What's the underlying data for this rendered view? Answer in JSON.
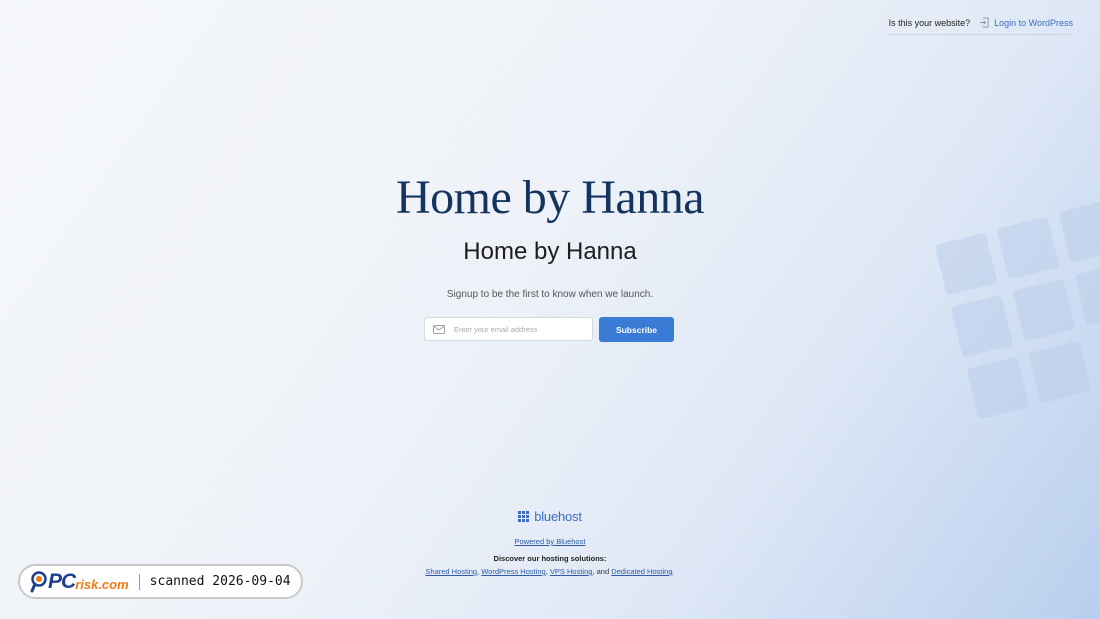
{
  "header": {
    "question": "Is this your website?",
    "login_link": "Login to WordPress"
  },
  "hero": {
    "logo_title": "Home by Hanna",
    "site_title": "Home by Hanna",
    "tagline": "Signup to be the first to know when we launch."
  },
  "signup": {
    "email_placeholder": "Enter your email address",
    "email_value": "",
    "subscribe_label": "Subscribe"
  },
  "footer": {
    "brand_name": "bluehost",
    "powered_by": "Powered by Bluehost",
    "discover_label": "Discover our hosting solutions:",
    "links": [
      "Shared Hosting",
      "WordPress Hosting",
      "VPS Hosting",
      "Dedicated Hosting"
    ],
    "sep_comma": ", ",
    "sep_and": ", and ",
    "end": "."
  },
  "watermark": {
    "brand_pc": "PC",
    "brand_risk": "risk.com",
    "scan_text": "scanned 2026-09-04"
  },
  "colors": {
    "accent": "#3a7bd5",
    "title": "#14345d",
    "link": "#3a6fbf"
  },
  "icons": {
    "login": "login-arrow-icon",
    "email": "envelope-icon",
    "brand": "grid-logo-icon",
    "watermark": "magnifier-icon"
  }
}
